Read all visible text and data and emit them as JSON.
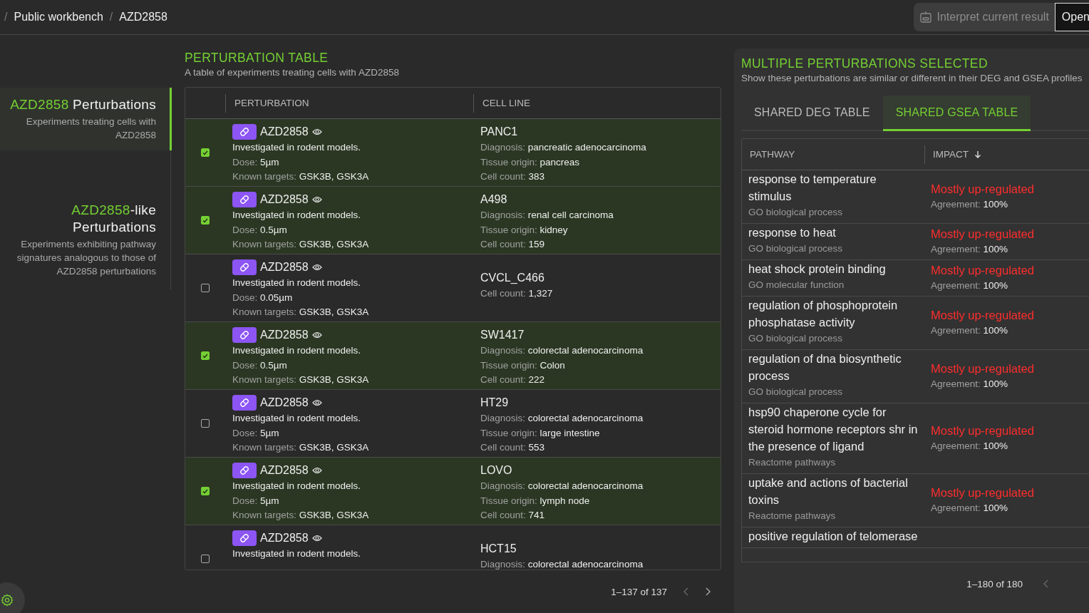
{
  "breadcrumbs": [
    {
      "separator": "/",
      "label": "Public workbench"
    },
    {
      "separator": "/",
      "label": "AZD2858"
    }
  ],
  "actions": [
    {
      "label": "Interpret current result",
      "kind": "assistant",
      "disabled": true
    },
    {
      "label": "Open",
      "kind": "plain",
      "disabled": false
    }
  ],
  "sidebar": {
    "items": [
      {
        "accent": "AZD2858",
        "title": " Perturbations",
        "description": "Experiments treating cells with AZD2858",
        "selected": true
      },
      {
        "accent": "AZD2858",
        "title": "-like Perturbations",
        "description": "Experiments exhibiting pathway signatures analogous to those of AZD2858 perturbations",
        "selected": false
      }
    ]
  },
  "perturbation_table": {
    "title": "PERTURBATION TABLE",
    "subtitle": "A table of experiments treating cells with AZD2858",
    "columns": [
      "PERTURBATION",
      "CELL LINE"
    ],
    "rows": [
      {
        "checked": true,
        "name": "AZD2858",
        "note": "Investigated in rodent models.",
        "details": [
          {
            "label": "Dose:",
            "value": "5µm"
          },
          {
            "label": "Known targets:",
            "value": "GSK3B, GSK3A"
          }
        ],
        "cell_line": "PANC1",
        "cell_details": [
          {
            "label": "Diagnosis:",
            "value": "pancreatic adenocarcinoma"
          },
          {
            "label": "Tissue origin:",
            "value": "pancreas"
          },
          {
            "label": "Cell count:",
            "value": "383"
          }
        ]
      },
      {
        "checked": true,
        "name": "AZD2858",
        "note": "Investigated in rodent models.",
        "details": [
          {
            "label": "Dose:",
            "value": "0.5µm"
          },
          {
            "label": "Known targets:",
            "value": "GSK3B, GSK3A"
          }
        ],
        "cell_line": "A498",
        "cell_details": [
          {
            "label": "Diagnosis:",
            "value": "renal cell carcinoma"
          },
          {
            "label": "Tissue origin:",
            "value": "kidney"
          },
          {
            "label": "Cell count:",
            "value": "159"
          }
        ]
      },
      {
        "checked": false,
        "name": "AZD2858",
        "note": "Investigated in rodent models.",
        "details": [
          {
            "label": "Dose:",
            "value": "0.05µm"
          },
          {
            "label": "Known targets:",
            "value": "GSK3B, GSK3A"
          }
        ],
        "cell_line": "CVCL_C466",
        "cell_details": [
          {
            "label": "Cell count:",
            "value": "1,327"
          }
        ]
      },
      {
        "checked": true,
        "name": "AZD2858",
        "note": "Investigated in rodent models.",
        "details": [
          {
            "label": "Dose:",
            "value": "0.5µm"
          },
          {
            "label": "Known targets:",
            "value": "GSK3B, GSK3A"
          }
        ],
        "cell_line": "SW1417",
        "cell_details": [
          {
            "label": "Diagnosis:",
            "value": "colorectal adenocarcinoma"
          },
          {
            "label": "Tissue origin:",
            "value": "Colon"
          },
          {
            "label": "Cell count:",
            "value": "222"
          }
        ]
      },
      {
        "checked": false,
        "name": "AZD2858",
        "note": "Investigated in rodent models.",
        "details": [
          {
            "label": "Dose:",
            "value": "5µm"
          },
          {
            "label": "Known targets:",
            "value": "GSK3B, GSK3A"
          }
        ],
        "cell_line": "HT29",
        "cell_details": [
          {
            "label": "Diagnosis:",
            "value": "colorectal adenocarcinoma"
          },
          {
            "label": "Tissue origin:",
            "value": "large intestine"
          },
          {
            "label": "Cell count:",
            "value": "553"
          }
        ]
      },
      {
        "checked": true,
        "name": "AZD2858",
        "note": "Investigated in rodent models.",
        "details": [
          {
            "label": "Dose:",
            "value": "5µm"
          },
          {
            "label": "Known targets:",
            "value": "GSK3B, GSK3A"
          }
        ],
        "cell_line": "LOVO",
        "cell_details": [
          {
            "label": "Diagnosis:",
            "value": "colorectal adenocarcinoma"
          },
          {
            "label": "Tissue origin:",
            "value": "lymph node"
          },
          {
            "label": "Cell count:",
            "value": "741"
          }
        ]
      },
      {
        "checked": false,
        "name": "AZD2858",
        "note": "Investigated in rodent models.",
        "details": [],
        "cell_line": "HCT15",
        "cell_details": [
          {
            "label": "Diagnosis:",
            "value": "colorectal adenocarcinoma"
          }
        ]
      }
    ],
    "pagination": "1–137 of 137"
  },
  "comparison_panel": {
    "title": "MULTIPLE PERTURBATIONS SELECTED",
    "subtitle": "Show these perturbations are similar or different in their DEG and GSEA profiles",
    "tabs": [
      {
        "label": "SHARED DEG TABLE",
        "selected": false
      },
      {
        "label": "SHARED GSEA TABLE",
        "selected": true
      }
    ],
    "columns": [
      "PATHWAY",
      "IMPACT"
    ],
    "rows": [
      {
        "pathway": "response to temperature stimulus",
        "source": "GO biological process",
        "impact": "Mostly up-regulated",
        "color": "#ff2d2d",
        "agreement_label": "Agreement:",
        "agreement": "100%"
      },
      {
        "pathway": "response to heat",
        "source": "GO biological process",
        "impact": "Mostly up-regulated",
        "color": "#ff2d2d",
        "agreement_label": "Agreement:",
        "agreement": "100%"
      },
      {
        "pathway": "heat shock protein binding",
        "source": "GO molecular function",
        "impact": "Mostly up-regulated",
        "color": "#ff2d2d",
        "agreement_label": "Agreement:",
        "agreement": "100%"
      },
      {
        "pathway": "regulation of phosphoprotein phosphatase activity",
        "source": "GO biological process",
        "impact": "Mostly up-regulated",
        "color": "#ff2d2d",
        "agreement_label": "Agreement:",
        "agreement": "100%"
      },
      {
        "pathway": "regulation of dna biosynthetic process",
        "source": "GO biological process",
        "impact": "Mostly up-regulated",
        "color": "#ff2d2d",
        "agreement_label": "Agreement:",
        "agreement": "100%"
      },
      {
        "pathway": "hsp90 chaperone cycle for steroid hormone receptors shr in the presence of ligand",
        "source": "Reactome pathways",
        "impact": "Mostly up-regulated",
        "color": "#ff2d2d",
        "agreement_label": "Agreement:",
        "agreement": "100%"
      },
      {
        "pathway": "uptake and actions of bacterial toxins",
        "source": "Reactome pathways",
        "impact": "Mostly up-regulated",
        "color": "#ff2d2d",
        "agreement_label": "Agreement:",
        "agreement": "100%"
      },
      {
        "pathway": "positive regulation of telomerase"
      }
    ],
    "pagination": "1–180 of 180"
  }
}
